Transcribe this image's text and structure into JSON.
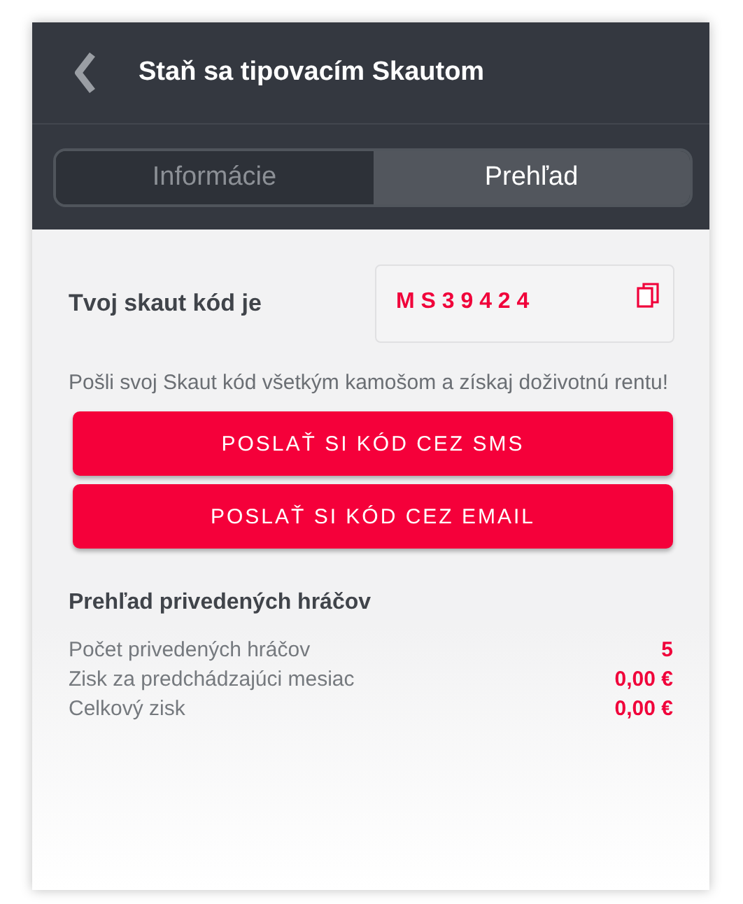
{
  "header": {
    "title": "Staň sa tipovacím Skautom"
  },
  "tabs": [
    {
      "label": "Informácie",
      "selected": false
    },
    {
      "label": "Prehľad",
      "selected": true
    }
  ],
  "code": {
    "label": "Tvoj skaut kód je",
    "value": "M S 3 9 4 2 4"
  },
  "message": "Pošli svoj Skaut kód všetkým kamošom a získaj doživotnú rentu!",
  "buttons": [
    "POSLAŤ SI KÓD CEZ SMS",
    "POSLAŤ SI KÓD CEZ EMAIL"
  ],
  "overview": {
    "title": "Prehľad privedených hráčov",
    "rows": [
      {
        "label": "Počet privedených hráčov",
        "value": "5"
      },
      {
        "label": "Zisk za predchádzajúci mesiac",
        "value": "0,00 €"
      },
      {
        "label": "Celkový zisk",
        "value": "0,00 €"
      }
    ]
  }
}
